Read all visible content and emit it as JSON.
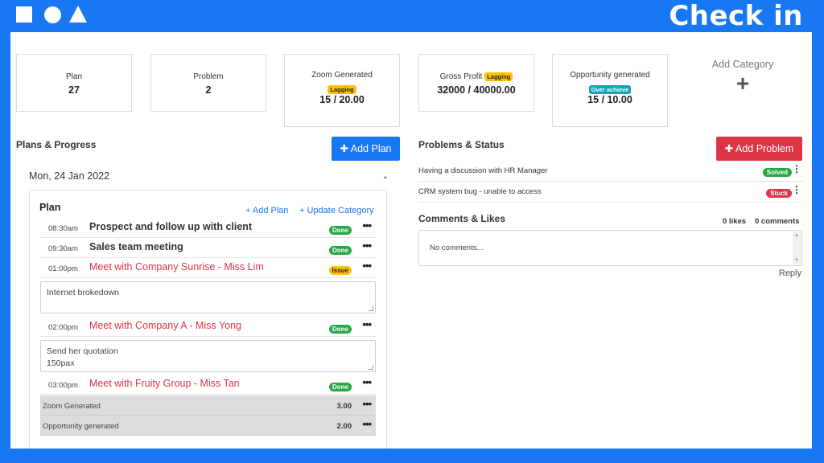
{
  "brand": {
    "title": "Check in",
    "shapes": [
      "square-shape",
      "circle-shape",
      "triangle-shape"
    ]
  },
  "stats": [
    {
      "label": "Plan",
      "value": "27"
    },
    {
      "label": "Problem",
      "value": "2"
    },
    {
      "label": "Zoom Generated",
      "badge": "Lagging",
      "value": "15 / 20.00"
    },
    {
      "label": "Gross Profit",
      "badge": "Lagging",
      "value": "32000 / 40000.00"
    },
    {
      "label": "Opportunity generated",
      "badge": "Over achieve",
      "value": "15 / 10.00"
    }
  ],
  "add_category": {
    "label": "Add Category",
    "icon": "plus-icon",
    "glyph": "+"
  },
  "plans_section": {
    "title": "Plans & Progress",
    "add_button": "Add Plan",
    "date": "Mon, 24 Jan 2022",
    "card": {
      "title": "Plan",
      "add_plan_link": "Add Plan",
      "update_category_link": "Update Category",
      "items": [
        {
          "time": "08:30am",
          "title": "Prospect and follow up with client",
          "status": "Done"
        },
        {
          "time": "09:30am",
          "title": "Sales team meeting",
          "status": "Done"
        },
        {
          "time": "01:00pm",
          "title": "Meet with Company Sunrise - Miss Lim",
          "status": "Issue",
          "note": "Internet brokedown"
        },
        {
          "time": "02:00pm",
          "title": "Meet with Company A - Miss Yong",
          "status": "Done",
          "note_lines": [
            "Send her quotation",
            "150pax"
          ]
        },
        {
          "time": "03:00pm",
          "title": "Meet with Fruity Group - Miss Tan",
          "status": "Done"
        }
      ],
      "metrics": [
        {
          "label": "Zoom Generated",
          "value": "3.00"
        },
        {
          "label": "Opportunity generated",
          "value": "2.00"
        }
      ]
    }
  },
  "problems_section": {
    "title": "Problems & Status",
    "add_button": "Add Problem",
    "items": [
      {
        "text": "Having a discussion with HR Manager",
        "status": "Solved"
      },
      {
        "text": "CRM system bug - unable to access",
        "status": "Stuck"
      }
    ]
  },
  "comments_section": {
    "title": "Comments & Likes",
    "likes": "0 likes",
    "comments": "0 comments",
    "placeholder": "No comments...",
    "reply": "Reply"
  },
  "colors": {
    "brand_blue": "#1877f2",
    "danger": "#dc3545",
    "success": "#28a745",
    "warning": "#ffc107",
    "info": "#17a2b8"
  }
}
